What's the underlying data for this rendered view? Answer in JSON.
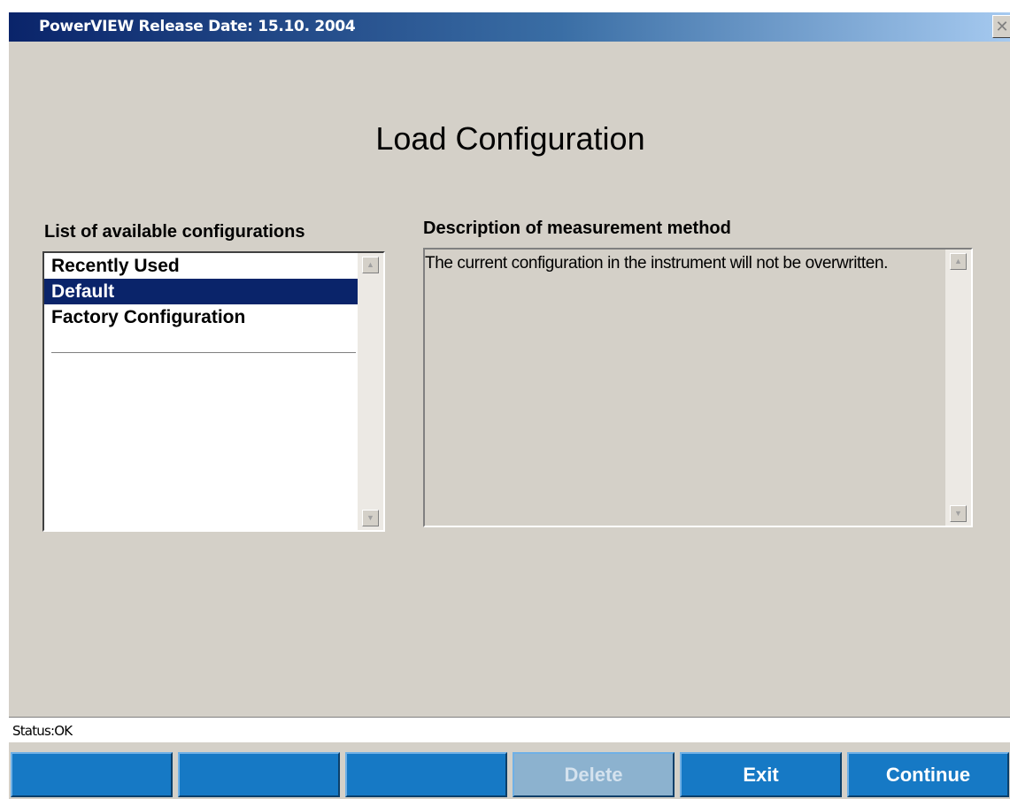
{
  "window": {
    "title": "PowerVIEW Release Date: 15.10. 2004",
    "close_glyph": "✕"
  },
  "heading": "Load Configuration",
  "configurations": {
    "label": "List of available configurations",
    "items": [
      {
        "label": "Recently Used",
        "selected": false
      },
      {
        "label": "Default",
        "selected": true
      },
      {
        "label": "Factory Configuration",
        "selected": false
      }
    ]
  },
  "description": {
    "label": "Description of measurement method",
    "text": "The current configuration in the instrument will not be overwritten."
  },
  "status": "Status:OK",
  "buttons": [
    {
      "label": "",
      "enabled": true
    },
    {
      "label": "",
      "enabled": true
    },
    {
      "label": "",
      "enabled": true
    },
    {
      "label": "Delete",
      "enabled": false
    },
    {
      "label": "Exit",
      "enabled": true
    },
    {
      "label": "Continue",
      "enabled": true
    }
  ],
  "icons": {
    "scroll_up": "▲",
    "scroll_down": "▼"
  },
  "colors": {
    "window_bg": "#d4d0c8",
    "title_bar_start": "#0a246a",
    "selection": "#0a246a",
    "button_bg": "#1679c5",
    "button_disabled_bg": "#8cb2cf"
  }
}
